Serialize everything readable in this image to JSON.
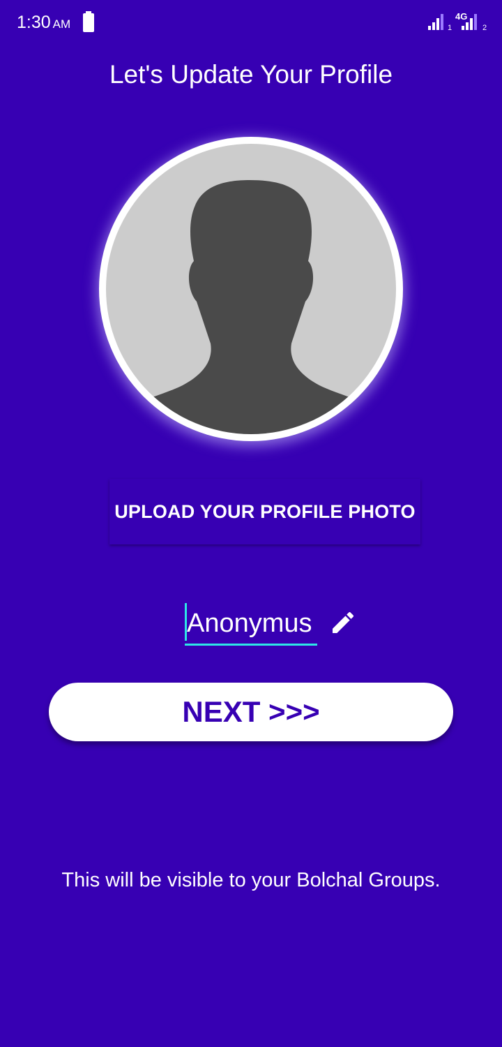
{
  "status_bar": {
    "time": "1:30",
    "ampm": "AM",
    "network_type": "4G",
    "sim1_label": "1",
    "sim2_label": "2"
  },
  "header": {
    "title": "Let's Update Your Profile"
  },
  "profile": {
    "avatar_icon": "default-person-silhouette",
    "upload_label": "UPLOAD YOUR PROFILE PHOTO",
    "name_value": "Anonymus",
    "edit_icon": "pencil-icon"
  },
  "actions": {
    "next_label": "NEXT >>>"
  },
  "footer": {
    "note": "This will be visible to your Bolchal Groups."
  },
  "colors": {
    "background": "#3700b3",
    "accent": "#2ee6e6",
    "avatar_bg": "#cccccc",
    "silhouette": "#4a4a4a",
    "button_bg": "#ffffff",
    "button_text": "#3700b3"
  }
}
